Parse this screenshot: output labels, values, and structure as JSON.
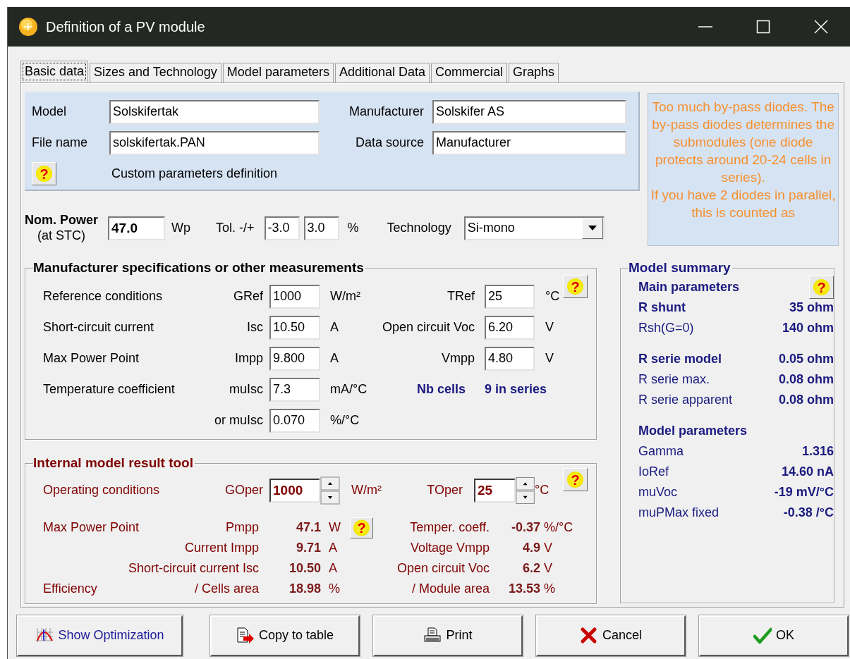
{
  "window": {
    "title": "Definition of a PV module"
  },
  "tabs": [
    {
      "label": "Basic data",
      "selected": true
    },
    {
      "label": "Sizes and Technology",
      "selected": false
    },
    {
      "label": "Model parameters",
      "selected": false
    },
    {
      "label": "Additional Data",
      "selected": false
    },
    {
      "label": "Commercial",
      "selected": false
    },
    {
      "label": "Graphs",
      "selected": false
    }
  ],
  "identity": {
    "fields": [
      {
        "label": "Model",
        "value": "Solskifertak"
      },
      {
        "label": "Manufacturer",
        "value": "Solskifer AS"
      },
      {
        "label": "File name",
        "value": "solskifertak.PAN"
      },
      {
        "label": "Data source",
        "value": "Manufacturer"
      }
    ],
    "help": "?",
    "note": "Custom parameters definition"
  },
  "warning": [
    "Too much by-pass diodes. The by-pass diodes determines the submodules (one diode protects around 20-24 cells in series).",
    "If you have 2 diodes in parallel, this is counted as"
  ],
  "nominal": {
    "label": "Nom. Power",
    "sublabel": "(at STC)",
    "value": "47.0",
    "unit": "Wp",
    "tolerance_label": "Tol. -/+",
    "tolerance_minus": "-3.0",
    "tolerance_plus": "3.0",
    "tolerance_unit": "%",
    "technology_label": "Technology",
    "technology": "Si-mono"
  },
  "specs": {
    "title": "Manufacturer specifications or other measurements",
    "help": "?",
    "rows": [
      {
        "label": "Reference conditions",
        "symbol": "GRef",
        "value": "1000",
        "unit": "W/m²",
        "symbol2": "TRef",
        "value2": "25",
        "unit2": "°C"
      },
      {
        "label": "Short-circuit current",
        "symbol": "Isc",
        "value": "10.50",
        "unit": "A",
        "symbol2": "Open circuit Voc",
        "value2": "6.20",
        "unit2": "V"
      },
      {
        "label": "Max Power Point",
        "symbol": "Impp",
        "value": "9.800",
        "unit": "A",
        "symbol2": "Vmpp",
        "value2": "4.80",
        "unit2": "V"
      },
      {
        "label": "Temperature coefficient",
        "symbol": "muIsc",
        "value": "7.3",
        "unit": "mA/°C"
      },
      {
        "symbol": "or muIsc",
        "value": "0.070",
        "unit": "%/°C"
      }
    ],
    "cells": {
      "label": "Nb cells",
      "value": "9 in series"
    }
  },
  "internal": {
    "title": "Internal model result tool",
    "help": "?",
    "operating": {
      "label": "Operating conditions",
      "g_symbol": "GOper",
      "g_value": "1000",
      "g_unit": "W/m²",
      "t_symbol": "TOper",
      "t_value": "25",
      "t_unit": "°C"
    },
    "results": [
      {
        "label": "Max Power Point",
        "symbol": "Pmpp",
        "value": "47.1",
        "unit": "W",
        "help": "?",
        "symbol2": "Temper. coeff.",
        "value2": "-0.37",
        "unit2": "%/°C"
      },
      {
        "symbol": "Current Impp",
        "value": "9.71",
        "unit": "A",
        "symbol2": "Voltage Vmpp",
        "value2": "4.9",
        "unit2": "V"
      },
      {
        "symbol": "Short-circuit current Isc",
        "value": "10.50",
        "unit": "A",
        "symbol2": "Open circuit Voc",
        "value2": "6.2",
        "unit2": "V"
      },
      {
        "label": "Efficiency",
        "symbol": "/ Cells area",
        "value": "18.98",
        "unit": "%",
        "symbol2": "/ Module area",
        "value2": "13.53",
        "unit2": "%"
      }
    ]
  },
  "summary": {
    "title": "Model summary",
    "sections": [
      {
        "heading": "Main parameters",
        "help": "?",
        "rows": [
          {
            "label": "R shunt",
            "value": "35 ohm",
            "emphasis": true
          },
          {
            "label": "Rsh(G=0)",
            "value": "140 ohm",
            "emphasis": false
          }
        ]
      },
      {
        "rows": [
          {
            "label": "R serie model",
            "value": "0.05 ohm",
            "emphasis": true
          },
          {
            "label": "R serie max.",
            "value": "0.08 ohm",
            "emphasis": false
          },
          {
            "label": "R serie apparent",
            "value": "0.08 ohm",
            "emphasis": false
          }
        ]
      },
      {
        "heading": "Model parameters",
        "rows": [
          {
            "label": "Gamma",
            "value": "1.316",
            "emphasis": false
          },
          {
            "label": "IoRef",
            "value": "14.60 nA",
            "emphasis": false
          },
          {
            "label": "muVoc",
            "value": "-19 mV/°C",
            "emphasis": false
          },
          {
            "label": "muPMax fixed",
            "value": "-0.38 /°C",
            "emphasis": false
          }
        ]
      }
    ]
  },
  "buttons": [
    {
      "label": "Show Optimization",
      "kind": "chart"
    },
    {
      "label": "Copy to table",
      "kind": "copy"
    },
    {
      "label": "Print",
      "kind": "print"
    },
    {
      "label": "Cancel",
      "kind": "cancel"
    },
    {
      "label": "OK",
      "kind": "ok"
    }
  ]
}
